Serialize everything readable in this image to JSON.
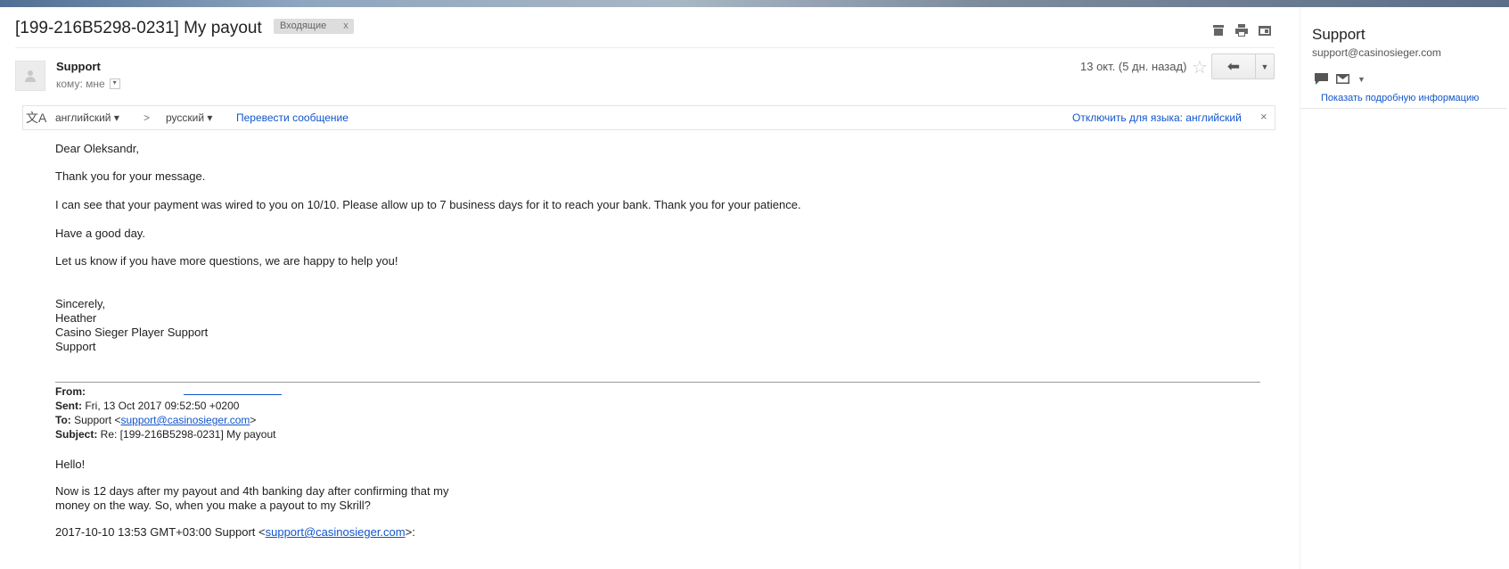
{
  "email": {
    "subject": "[199-216B5298-0231] My payout",
    "label": "Входящие",
    "label_close": "x",
    "sender": "Support",
    "to": "кому: мне",
    "date": "13 окт. (5 дн. назад)",
    "star": "☆",
    "reply": "⬅",
    "reply_more": "▼"
  },
  "translate": {
    "from": "английский ▾",
    "arrow": ">",
    "to": "русский ▾",
    "translate_link": "Перевести сообщение",
    "disable_link": "Отключить для языка: английский",
    "close": "×",
    "icon": "文A"
  },
  "body": {
    "greeting": "Dear Oleksandr,",
    "p1": "Thank you for your message.",
    "p2": "I can see that your payment was wired to you on 10/10. Please allow up to 7 business days for it to reach your bank. Thank you for your patience.",
    "p3": "Have a good day.",
    "p4": "Let us know if you have more questions, we are happy to help you!",
    "sig1": "Sincerely,",
    "sig2": "Heather",
    "sig3": "Casino Sieger Player Support",
    "sig4": "Support"
  },
  "quoted": {
    "from_label": "From:",
    "sent_label": "Sent:",
    "sent_value": " Fri, 13 Oct 2017 09:52:50 +0200",
    "to_label": "To:",
    "to_prefix": " Support <",
    "to_email": "support@casinosieger.com",
    "to_suffix": ">",
    "subject_label": "Subject:",
    "subject_value": " Re: [199-216B5298-0231] My payout",
    "hello": "Hello!",
    "line1": "Now is 12 days after my payout and 4th banking day after confirming that my",
    "line2": "money on the way. So, when you make a payout to my Skrill?",
    "earlier_prefix": "2017-10-10 13:53 GMT+03:00 Support <",
    "earlier_email": "support@casinosieger.com",
    "earlier_suffix": ">:"
  },
  "sidebar": {
    "name": "Support",
    "email": "support@casinosieger.com",
    "details_link": "Показать подробную информацию"
  },
  "icons": {
    "archive": "archive-icon",
    "print": "print-icon",
    "new_window": "new-window-icon"
  }
}
